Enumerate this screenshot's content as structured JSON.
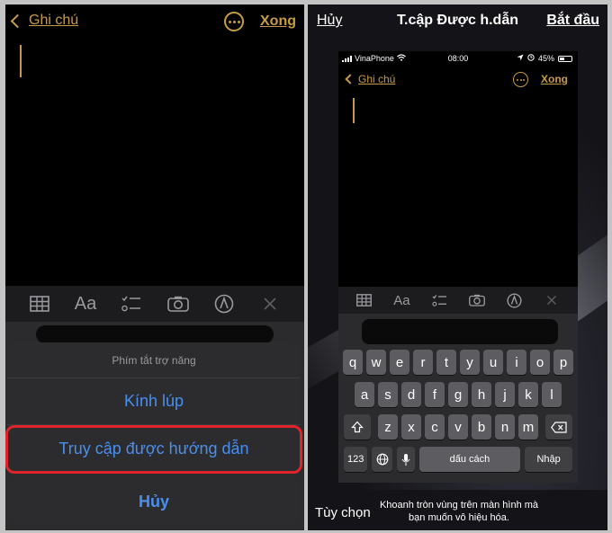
{
  "left": {
    "nav": {
      "back": "Ghi chú",
      "done": "Xong"
    },
    "toolbar_icons": [
      "table-icon",
      "text-format-icon",
      "checklist-icon",
      "camera-icon",
      "markup-icon",
      "close-icon"
    ],
    "toolbar_text_format": "Aa",
    "sheet": {
      "title": "Phím tắt trợ năng",
      "items": [
        "Kính lúp",
        "Truy cập được hướng dẫn"
      ],
      "cancel": "Hủy"
    },
    "highlight_color": "#e0252a"
  },
  "right": {
    "nav": {
      "cancel": "Hủy",
      "title": "T.cập Được h.dẫn",
      "start": "Bắt đầu"
    },
    "status": {
      "carrier": "VinaPhone",
      "time": "08:00",
      "battery": "45%"
    },
    "mini_nav": {
      "back": "Ghi chú",
      "done": "Xong"
    },
    "toolbar_text_format": "Aa",
    "keyboard": {
      "row1": [
        "q",
        "w",
        "e",
        "r",
        "t",
        "y",
        "u",
        "i",
        "o",
        "p"
      ],
      "row2": [
        "a",
        "s",
        "d",
        "f",
        "g",
        "h",
        "j",
        "k",
        "l"
      ],
      "row3": [
        "z",
        "x",
        "c",
        "v",
        "b",
        "n",
        "m"
      ],
      "numbers": "123",
      "space": "dấu cách",
      "enter": "Nhập"
    },
    "bottom": {
      "options": "Tùy chọn",
      "hint": "Khoanh tròn vùng trên màn hình mà bạn muốn vô hiệu hóa."
    }
  },
  "colors": {
    "accent": "#c79b45",
    "link_blue": "#4a8ff0"
  }
}
